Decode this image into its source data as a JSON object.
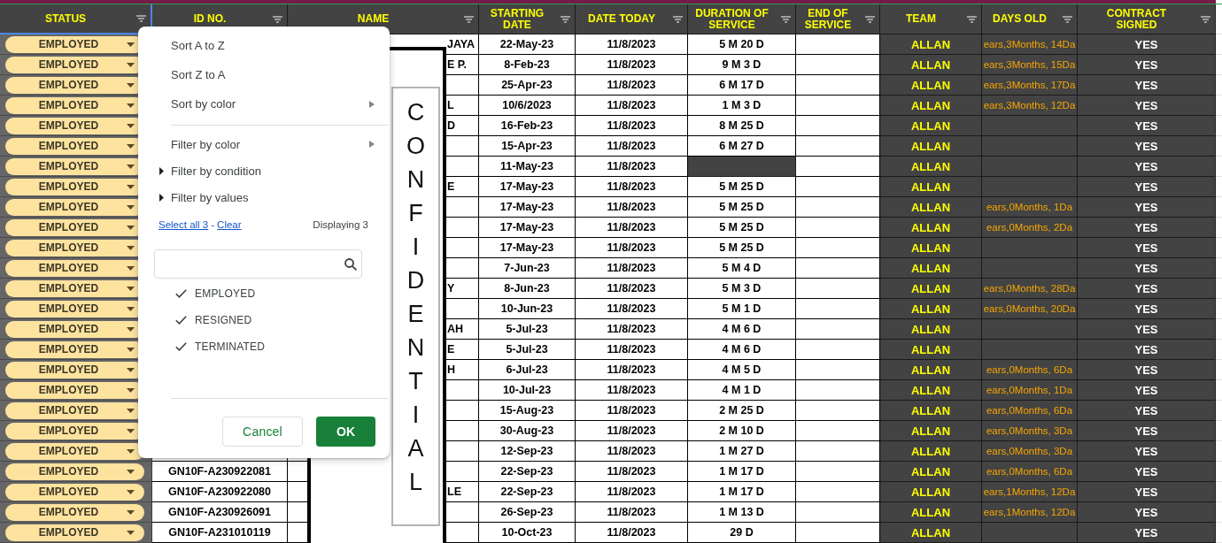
{
  "columns": [
    {
      "label": "STATUS",
      "selected": true
    },
    {
      "label": "ID NO.",
      "selected": false
    },
    {
      "label": "NAME",
      "selected": false
    },
    {
      "label": "STARTING\nDATE",
      "selected": false
    },
    {
      "label": "DATE TODAY",
      "selected": false
    },
    {
      "label": "DURATION OF\nSERVICE",
      "selected": false
    },
    {
      "label": "END OF\nSERVICE",
      "selected": false
    },
    {
      "label": "TEAM",
      "selected": false
    },
    {
      "label": "DAYS OLD",
      "selected": false
    },
    {
      "label": "CONTRACT\nSIGNED",
      "selected": false
    }
  ],
  "rows": [
    {
      "status": "EMPLOYED",
      "name": "JAYA",
      "starting_date": "22-May-23",
      "date_today": "11/8/2023",
      "duration": "5 M 20 D",
      "duration_shaded": false,
      "team": "ALLAN",
      "days_old": "ears,3Months, 14Da",
      "contract_signed": "YES"
    },
    {
      "status": "EMPLOYED",
      "name": "E P.",
      "starting_date": "8-Feb-23",
      "date_today": "11/8/2023",
      "duration": "9 M 3 D",
      "duration_shaded": false,
      "team": "ALLAN",
      "days_old": "ears,3Months, 15Da",
      "contract_signed": "YES"
    },
    {
      "status": "EMPLOYED",
      "starting_date": "25-Apr-23",
      "date_today": "11/8/2023",
      "duration": "6 M 17 D",
      "duration_shaded": false,
      "team": "ALLAN",
      "days_old": "ears,3Months, 17Da",
      "contract_signed": "YES"
    },
    {
      "status": "EMPLOYED",
      "name": "L",
      "starting_date": "10/6/2023",
      "date_today": "11/8/2023",
      "duration": "1 M 3 D",
      "duration_shaded": false,
      "team": "ALLAN",
      "days_old": "ears,3Months, 12Da",
      "contract_signed": "YES"
    },
    {
      "status": "EMPLOYED",
      "name": "D",
      "starting_date": "16-Feb-23",
      "date_today": "11/8/2023",
      "duration": "8 M 25 D",
      "duration_shaded": false,
      "team": "ALLAN",
      "contract_signed": "YES"
    },
    {
      "status": "EMPLOYED",
      "starting_date": "15-Apr-23",
      "date_today": "11/8/2023",
      "duration": "6 M 27 D",
      "duration_shaded": false,
      "team": "ALLAN",
      "contract_signed": "YES"
    },
    {
      "status": "EMPLOYED",
      "starting_date": "11-May-23",
      "date_today": "11/8/2023",
      "duration_shaded": true,
      "team": "ALLAN",
      "contract_signed": "YES"
    },
    {
      "status": "EMPLOYED",
      "name": "E",
      "starting_date": "17-May-23",
      "date_today": "11/8/2023",
      "duration": "5 M 25 D",
      "duration_shaded": false,
      "team": "ALLAN",
      "contract_signed": "YES"
    },
    {
      "status": "EMPLOYED",
      "starting_date": "17-May-23",
      "date_today": "11/8/2023",
      "duration": "5 M 25 D",
      "duration_shaded": false,
      "team": "ALLAN",
      "days_old": "ears,0Months, 1Da",
      "contract_signed": "YES"
    },
    {
      "status": "EMPLOYED",
      "starting_date": "17-May-23",
      "date_today": "11/8/2023",
      "duration": "5 M 25 D",
      "duration_shaded": false,
      "team": "ALLAN",
      "days_old": "ears,0Months, 2Da",
      "contract_signed": "YES"
    },
    {
      "status": "EMPLOYED",
      "starting_date": "17-May-23",
      "date_today": "11/8/2023",
      "duration": "5 M 25 D",
      "duration_shaded": false,
      "team": "ALLAN",
      "contract_signed": "YES"
    },
    {
      "status": "EMPLOYED",
      "starting_date": "7-Jun-23",
      "date_today": "11/8/2023",
      "duration": "5 M 4 D",
      "duration_shaded": false,
      "team": "ALLAN",
      "contract_signed": "YES"
    },
    {
      "status": "EMPLOYED",
      "name": "Y",
      "starting_date": "8-Jun-23",
      "date_today": "11/8/2023",
      "duration": "5 M 3 D",
      "duration_shaded": false,
      "team": "ALLAN",
      "days_old": "ears,0Months, 28Da",
      "contract_signed": "YES"
    },
    {
      "status": "EMPLOYED",
      "starting_date": "10-Jun-23",
      "date_today": "11/8/2023",
      "duration": "5 M 1 D",
      "duration_shaded": false,
      "team": "ALLAN",
      "days_old": "ears,0Months, 20Da",
      "contract_signed": "YES"
    },
    {
      "status": "EMPLOYED",
      "name": "AH",
      "starting_date": "5-Jul-23",
      "date_today": "11/8/2023",
      "duration": "4 M 6 D",
      "duration_shaded": false,
      "team": "ALLAN",
      "contract_signed": "YES"
    },
    {
      "status": "EMPLOYED",
      "name": "E",
      "starting_date": "5-Jul-23",
      "date_today": "11/8/2023",
      "duration": "4 M 6 D",
      "duration_shaded": false,
      "team": "ALLAN",
      "contract_signed": "YES"
    },
    {
      "status": "EMPLOYED",
      "name": "H",
      "starting_date": "6-Jul-23",
      "date_today": "11/8/2023",
      "duration": "4 M 5 D",
      "duration_shaded": false,
      "team": "ALLAN",
      "days_old": "ears,0Months, 6Da",
      "contract_signed": "YES"
    },
    {
      "status": "EMPLOYED",
      "starting_date": "10-Jul-23",
      "date_today": "11/8/2023",
      "duration": "4 M 1 D",
      "duration_shaded": false,
      "team": "ALLAN",
      "days_old": "ears,0Months, 1Da",
      "contract_signed": "YES"
    },
    {
      "status": "EMPLOYED",
      "starting_date": "15-Aug-23",
      "date_today": "11/8/2023",
      "duration": "2 M 25 D",
      "duration_shaded": false,
      "team": "ALLAN",
      "days_old": "ears,0Months, 6Da",
      "contract_signed": "YES"
    },
    {
      "status": "EMPLOYED",
      "starting_date": "30-Aug-23",
      "date_today": "11/8/2023",
      "duration": "2 M 10 D",
      "duration_shaded": false,
      "team": "ALLAN",
      "days_old": "ears,0Months, 3Da",
      "contract_signed": "YES"
    },
    {
      "status": "EMPLOYED",
      "starting_date": "12-Sep-23",
      "date_today": "11/8/2023",
      "duration": "1 M 27 D",
      "duration_shaded": false,
      "team": "ALLAN",
      "days_old": "ears,0Months, 3Da",
      "contract_signed": "YES"
    },
    {
      "status": "EMPLOYED",
      "id": "GN10F-A230922081",
      "starting_date": "22-Sep-23",
      "date_today": "11/8/2023",
      "duration": "1 M 17 D",
      "duration_shaded": false,
      "team": "ALLAN",
      "days_old": "ears,0Months, 6Da",
      "contract_signed": "YES"
    },
    {
      "status": "EMPLOYED",
      "id": "GN10F-A230922080",
      "name": "LE",
      "starting_date": "22-Sep-23",
      "date_today": "11/8/2023",
      "duration": "1 M 17 D",
      "duration_shaded": false,
      "team": "ALLAN",
      "days_old": "ears,1Months, 12Da",
      "contract_signed": "YES"
    },
    {
      "status": "EMPLOYED",
      "id": "GN10F-A230926091",
      "starting_date": "26-Sep-23",
      "date_today": "11/8/2023",
      "duration": "1 M 13 D",
      "duration_shaded": false,
      "team": "ALLAN",
      "days_old": "ears,1Months, 12Da",
      "contract_signed": "YES"
    },
    {
      "status": "EMPLOYED",
      "id": "GN10F-A231010119",
      "starting_date": "10-Oct-23",
      "date_today": "11/8/2023",
      "duration": "29 D",
      "duration_shaded": false,
      "team": "ALLAN",
      "contract_signed": "YES"
    }
  ],
  "confidential_overlay": {
    "text": "CONFIDENTIAL"
  },
  "filter_menu": {
    "items": [
      {
        "kind": "action",
        "label": "Sort A to Z"
      },
      {
        "kind": "action",
        "label": "Sort Z to A"
      },
      {
        "kind": "submenu",
        "label": "Sort by color"
      },
      {
        "kind": "divider"
      },
      {
        "kind": "submenu",
        "label": "Filter by color"
      },
      {
        "kind": "section",
        "label": "Filter by condition"
      },
      {
        "kind": "section",
        "label": "Filter by values"
      }
    ],
    "select_all": "Select all 3",
    "separator": "-",
    "clear": "Clear",
    "displaying": "Displaying 3",
    "values": [
      {
        "label": "EMPLOYED",
        "checked": true
      },
      {
        "label": "RESIGNED",
        "checked": true
      },
      {
        "label": "TERMINATED",
        "checked": true
      }
    ],
    "buttons": [
      {
        "kind": "secondary",
        "label": "Cancel"
      },
      {
        "kind": "primary",
        "label": "OK"
      }
    ]
  }
}
